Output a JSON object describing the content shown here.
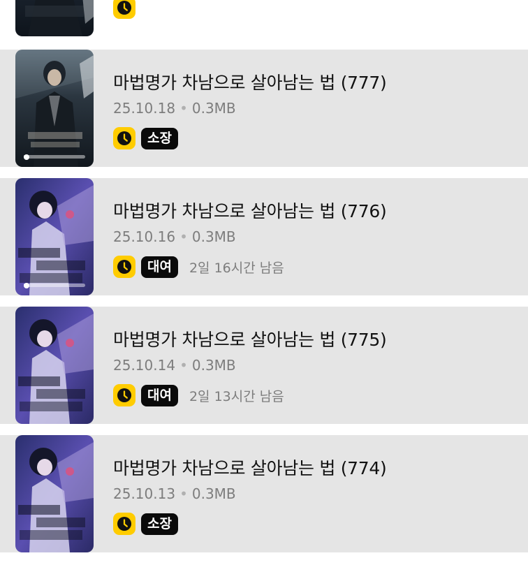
{
  "items": [
    {
      "title": "",
      "date": "",
      "size": "",
      "tag": "",
      "remaining": "",
      "cover": "dark",
      "read_progress": null,
      "highlight": false
    },
    {
      "title": "마법명가 차남으로 살아남는 법 (777)",
      "date": "25.10.18",
      "size": "0.3MB",
      "tag": "소장",
      "remaining": "",
      "cover": "dark",
      "read_progress": 0.05,
      "highlight": true
    },
    {
      "title": "마법명가 차남으로 살아남는 법 (776)",
      "date": "25.10.16",
      "size": "0.3MB",
      "tag": "대여",
      "remaining": "2일 16시간 남음",
      "cover": "purple",
      "read_progress": 0.05,
      "highlight": true
    },
    {
      "title": "마법명가 차남으로 살아남는 법 (775)",
      "date": "25.10.14",
      "size": "0.3MB",
      "tag": "대여",
      "remaining": "2일 13시간 남음",
      "cover": "purple",
      "read_progress": null,
      "highlight": true
    },
    {
      "title": "마법명가 차남으로 살아남는 법 (774)",
      "date": "25.10.13",
      "size": "0.3MB",
      "tag": "소장",
      "remaining": "",
      "cover": "purple",
      "read_progress": null,
      "highlight": true
    }
  ],
  "colors": {
    "badge_yellow": "#ffcc00",
    "tag_black": "#0a0a0a",
    "row_background": "#e5e5e5",
    "meta_gray": "#7d7d7d"
  },
  "icons": {
    "status": "clock-icon"
  }
}
